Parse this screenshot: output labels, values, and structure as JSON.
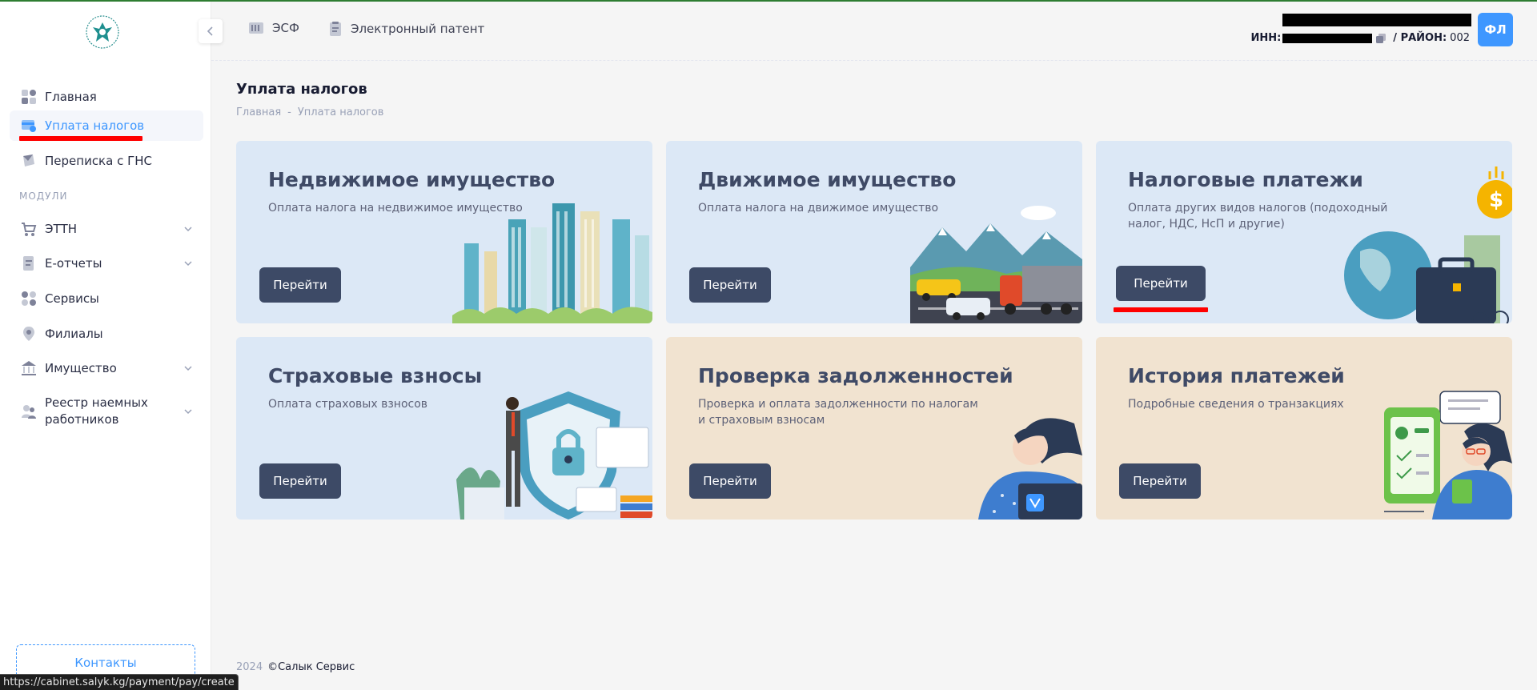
{
  "sidebar": {
    "items": [
      {
        "label": "Главная",
        "icon": "dashboard-icon"
      },
      {
        "label": "Уплата налогов",
        "icon": "payment-icon",
        "active": true
      },
      {
        "label": "Переписка с ГНС",
        "icon": "mail-icon"
      }
    ],
    "section_label": "МОДУЛИ",
    "modules": [
      {
        "label": "ЭТТН",
        "icon": "cart-icon"
      },
      {
        "label": "Е-отчеты",
        "icon": "reports-icon"
      },
      {
        "label": "Сервисы",
        "icon": "services-icon"
      },
      {
        "label": "Филиалы",
        "icon": "location-icon"
      },
      {
        "label": "Имущество",
        "icon": "bank-icon"
      },
      {
        "label": "Реестр наемных работников",
        "icon": "people-icon"
      }
    ],
    "contacts_label": "Контакты"
  },
  "header": {
    "links": [
      {
        "label": "ЭСФ",
        "icon": "invoice-icon"
      },
      {
        "label": "Электронный патент",
        "icon": "patent-icon"
      }
    ],
    "inn_label": "ИНН:",
    "region_label": "/ РАЙОН:",
    "region_value": "002",
    "avatar_text": "ФЛ"
  },
  "page": {
    "title": "Уплата налогов",
    "breadcrumb": [
      "Главная",
      "-",
      "Уплата налогов"
    ]
  },
  "cards": [
    {
      "title": "Недвижимое имущество",
      "desc": "Оплата налога на недвижимое имущество",
      "button": "Перейти"
    },
    {
      "title": "Движимое имущество",
      "desc": "Оплата налога на движимое имущество",
      "button": "Перейти"
    },
    {
      "title": "Налоговые платежи",
      "desc": "Оплата других видов налогов (подоходный налог, НДС, НсП и другие)",
      "button": "Перейти"
    },
    {
      "title": "Страховые взносы",
      "desc": "Оплата страховых взносов",
      "button": "Перейти"
    },
    {
      "title": "Проверка задолженностей",
      "desc": "Проверка и оплата задолженности по налогам и страховым взносам",
      "button": "Перейти"
    },
    {
      "title": "История платежей",
      "desc": "Подробные сведения о транзакциях",
      "button": "Перейти"
    }
  ],
  "footer": {
    "year": "2024",
    "copyright": "©Салык Сервис"
  },
  "status_bar": {
    "url": "https://cabinet.salyk.kg/payment/pay/create"
  },
  "colors": {
    "accent": "#3e97ff",
    "button": "#3d4a66",
    "card_blue": "#dce8f6",
    "card_beige": "#f1e3d0",
    "highlight": "#ff0000"
  }
}
